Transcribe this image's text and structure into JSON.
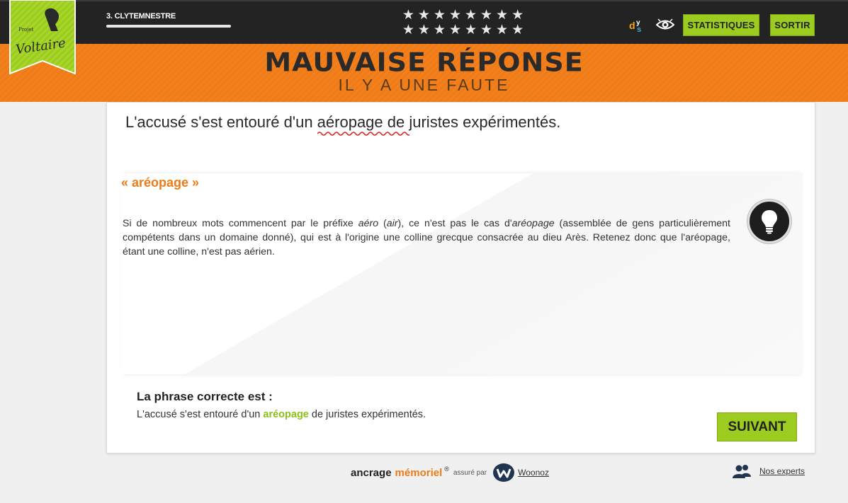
{
  "header": {
    "logo_text_top": "Projet",
    "logo_text_main": "Voltaire",
    "level_name": "3. CLYTEMNESTRE",
    "stars_row1": "★★★★★★★★",
    "stars_row2": "★★★★★★★★",
    "dys_label": "dys",
    "stats_button": "STATISTIQUES",
    "exit_button": "SORTIR"
  },
  "banner": {
    "title": "MAUVAISE RÉPONSE",
    "subtitle": "IL Y A UNE FAUTE"
  },
  "question": {
    "before": "L'accusé s'est entouré d'un ",
    "error_word": "aéropage",
    "after": " de juristes expérimentés."
  },
  "rule": {
    "word": "« aréopage »",
    "text_1": "Si de nombreux mots commencent par le préfixe ",
    "text_aero": "aéro",
    "text_2": " (",
    "text_air": "air",
    "text_3": "), ce n'est pas le cas d'",
    "text_areo": "aréopage",
    "text_4": " (assemblée de gens particulièrement compétents dans un domaine donné), qui est à l'origine une colline grecque consacrée au dieu Arès. Retenez donc que l'aréopage, étant une colline, n'est pas aérien."
  },
  "correct": {
    "label": "La phrase correcte est :",
    "before": "L'accusé s'est entouré d'un ",
    "word": "aréopage",
    "after": " de juristes expérimentés.",
    "next_button": "SUIVANT"
  },
  "footer": {
    "ancrage": "ancrage",
    "memoriel": "mémoriel",
    "registered": "®",
    "assure": "assuré par",
    "woonoz": "Woonoz",
    "experts": "Nos experts"
  },
  "colors": {
    "accent_green": "#9ccc1f",
    "accent_orange": "#ee7b18",
    "topbar": "#232323"
  }
}
